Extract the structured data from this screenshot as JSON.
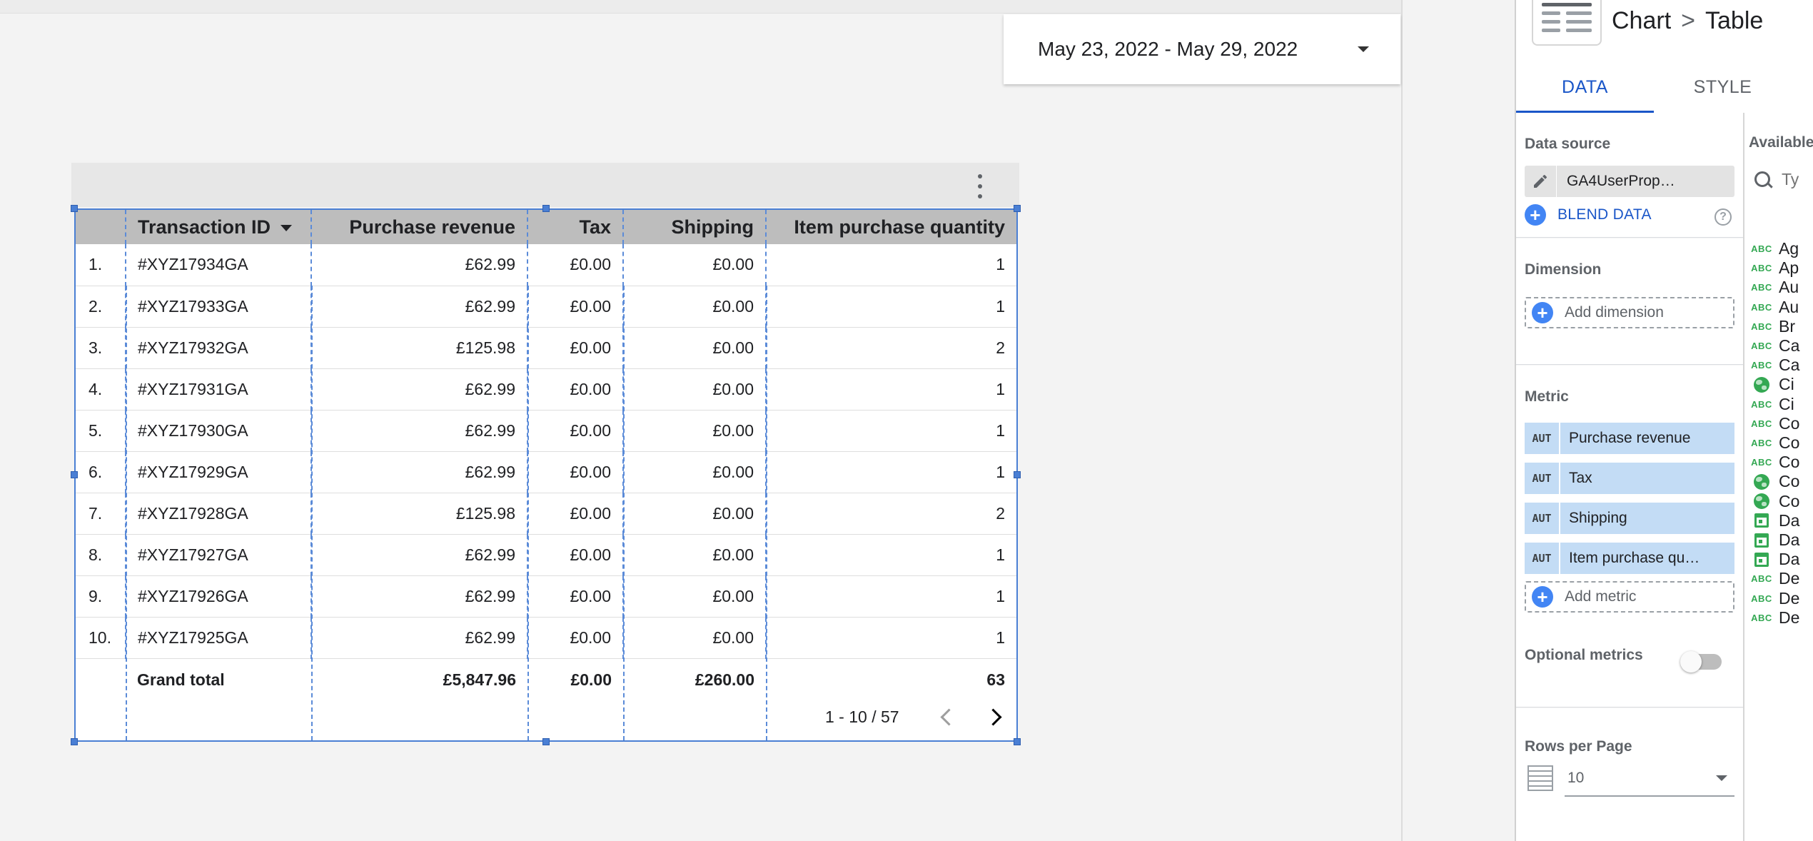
{
  "date_range": {
    "label": "May 23, 2022 - May 29, 2022"
  },
  "table": {
    "headers": {
      "transaction_id": "Transaction ID",
      "purchase_revenue": "Purchase revenue",
      "tax": "Tax",
      "shipping": "Shipping",
      "item_quantity": "Item purchase quantity"
    },
    "rows": [
      {
        "index": "1.",
        "transaction_id": "#XYZ17934GA",
        "purchase_revenue": "£62.99",
        "tax": "£0.00",
        "shipping": "£0.00",
        "item_quantity": "1"
      },
      {
        "index": "2.",
        "transaction_id": "#XYZ17933GA",
        "purchase_revenue": "£62.99",
        "tax": "£0.00",
        "shipping": "£0.00",
        "item_quantity": "1"
      },
      {
        "index": "3.",
        "transaction_id": "#XYZ17932GA",
        "purchase_revenue": "£125.98",
        "tax": "£0.00",
        "shipping": "£0.00",
        "item_quantity": "2"
      },
      {
        "index": "4.",
        "transaction_id": "#XYZ17931GA",
        "purchase_revenue": "£62.99",
        "tax": "£0.00",
        "shipping": "£0.00",
        "item_quantity": "1"
      },
      {
        "index": "5.",
        "transaction_id": "#XYZ17930GA",
        "purchase_revenue": "£62.99",
        "tax": "£0.00",
        "shipping": "£0.00",
        "item_quantity": "1"
      },
      {
        "index": "6.",
        "transaction_id": "#XYZ17929GA",
        "purchase_revenue": "£62.99",
        "tax": "£0.00",
        "shipping": "£0.00",
        "item_quantity": "1"
      },
      {
        "index": "7.",
        "transaction_id": "#XYZ17928GA",
        "purchase_revenue": "£125.98",
        "tax": "£0.00",
        "shipping": "£0.00",
        "item_quantity": "2"
      },
      {
        "index": "8.",
        "transaction_id": "#XYZ17927GA",
        "purchase_revenue": "£62.99",
        "tax": "£0.00",
        "shipping": "£0.00",
        "item_quantity": "1"
      },
      {
        "index": "9.",
        "transaction_id": "#XYZ17926GA",
        "purchase_revenue": "£62.99",
        "tax": "£0.00",
        "shipping": "£0.00",
        "item_quantity": "1"
      },
      {
        "index": "10.",
        "transaction_id": "#XYZ17925GA",
        "purchase_revenue": "£62.99",
        "tax": "£0.00",
        "shipping": "£0.00",
        "item_quantity": "1"
      }
    ],
    "grand_total": {
      "label": "Grand total",
      "purchase_revenue": "£5,847.96",
      "tax": "£0.00",
      "shipping": "£260.00",
      "item_quantity": "63"
    },
    "pagination": {
      "range": "1 - 10 / 57"
    }
  },
  "panel": {
    "breadcrumb": {
      "parent": "Chart",
      "separator": ">",
      "current": "Table"
    },
    "tabs": {
      "data": "DATA",
      "style": "STYLE",
      "active": "data"
    },
    "data_source": {
      "title": "Data source",
      "name": "GA4UserProp…",
      "blend_label": "BLEND DATA"
    },
    "dimension": {
      "title": "Dimension",
      "add_label": "Add dimension"
    },
    "metric": {
      "title": "Metric",
      "items": [
        {
          "agg": "AUT",
          "name": "Purchase revenue"
        },
        {
          "agg": "AUT",
          "name": "Tax"
        },
        {
          "agg": "AUT",
          "name": "Shipping"
        },
        {
          "agg": "AUT",
          "name": "Item purchase qu…"
        }
      ],
      "add_label": "Add metric"
    },
    "optional_metrics": {
      "label": "Optional metrics",
      "enabled": false
    },
    "rows_per_page": {
      "title": "Rows per Page",
      "value": "10"
    },
    "available_fields": {
      "title": "Available",
      "search_placeholder": "Ty",
      "items": [
        {
          "type": "text",
          "icon_label": "ABC",
          "name": "Ag"
        },
        {
          "type": "text",
          "icon_label": "ABC",
          "name": "Ap"
        },
        {
          "type": "text",
          "icon_label": "ABC",
          "name": "Au"
        },
        {
          "type": "text",
          "icon_label": "ABC",
          "name": "Au"
        },
        {
          "type": "text",
          "icon_label": "ABC",
          "name": "Br"
        },
        {
          "type": "text",
          "icon_label": "ABC",
          "name": "Ca"
        },
        {
          "type": "text",
          "icon_label": "ABC",
          "name": "Ca"
        },
        {
          "type": "geo",
          "icon_label": "",
          "name": "Ci"
        },
        {
          "type": "text",
          "icon_label": "ABC",
          "name": "Ci"
        },
        {
          "type": "text",
          "icon_label": "ABC",
          "name": "Co"
        },
        {
          "type": "text",
          "icon_label": "ABC",
          "name": "Co"
        },
        {
          "type": "text",
          "icon_label": "ABC",
          "name": "Co"
        },
        {
          "type": "geo",
          "icon_label": "",
          "name": "Co"
        },
        {
          "type": "geo",
          "icon_label": "",
          "name": "Co"
        },
        {
          "type": "date",
          "icon_label": "",
          "name": "Da"
        },
        {
          "type": "date",
          "icon_label": "",
          "name": "Da"
        },
        {
          "type": "date",
          "icon_label": "",
          "name": "Da"
        },
        {
          "type": "text",
          "icon_label": "ABC",
          "name": "De"
        },
        {
          "type": "text",
          "icon_label": "ABC",
          "name": "De"
        },
        {
          "type": "text",
          "icon_label": "ABC",
          "name": "De"
        }
      ]
    }
  },
  "colors": {
    "accent": "#1a56c8",
    "selection": "#4a7fd4",
    "metric_chip": "#c3dcf5",
    "field_type": "#34a853"
  }
}
